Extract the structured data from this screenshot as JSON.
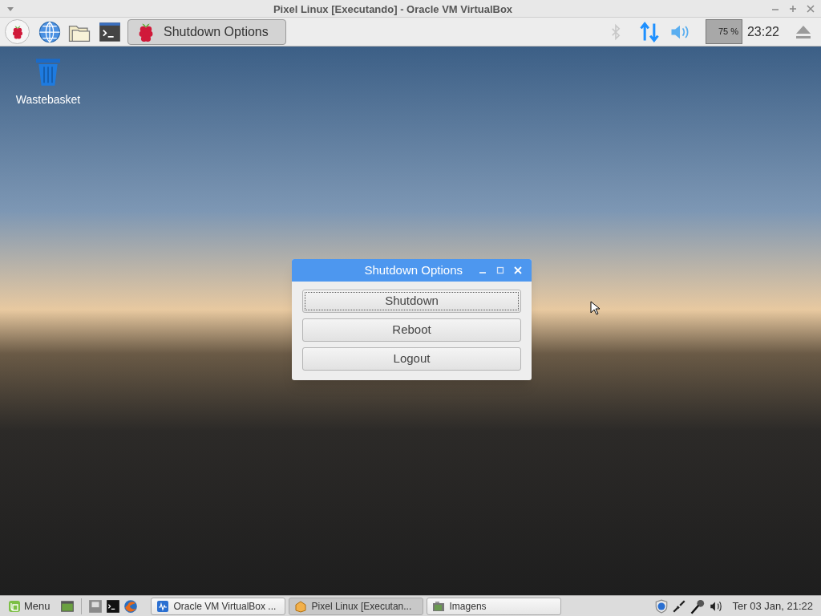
{
  "host_window": {
    "title": "Pixel Linux [Executando] - Oracle VM VirtualBox"
  },
  "pixel_panel": {
    "tasks": [
      {
        "label": "Shutdown Options",
        "selected": true
      }
    ],
    "cpu_reading": "75",
    "cpu_unit": "%",
    "clock": "23:22"
  },
  "desktop": {
    "icons": [
      {
        "label": "Wastebasket"
      }
    ]
  },
  "dialog": {
    "title": "Shutdown Options",
    "buttons": [
      {
        "label": "Shutdown",
        "focused": true
      },
      {
        "label": "Reboot",
        "focused": false
      },
      {
        "label": "Logout",
        "focused": false
      }
    ]
  },
  "host_taskbar": {
    "menu_label": "Menu",
    "tasks": [
      {
        "label": "Oracle VM VirtualBox ...",
        "kind": "vbox",
        "selected": false
      },
      {
        "label": "Pixel Linux [Executan...",
        "kind": "vm",
        "selected": true
      },
      {
        "label": "Imagens",
        "kind": "images",
        "selected": false
      }
    ],
    "clock": "Ter 03 Jan, 21:22"
  }
}
